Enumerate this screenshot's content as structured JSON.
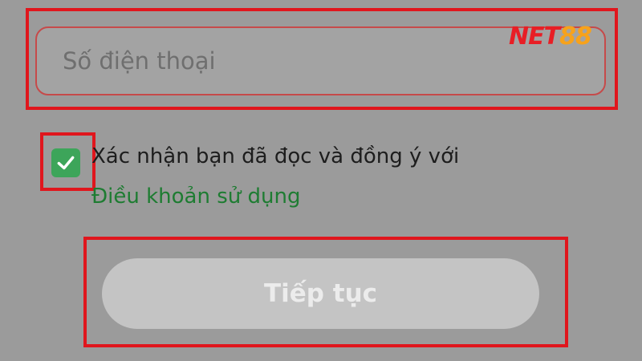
{
  "form": {
    "phone_placeholder": "Số điện thoại",
    "phone_value": "",
    "agree_checked": true,
    "agree_text": "Xác nhận bạn đã đọc và đồng ý với",
    "terms_link": "Điều khoản sử dụng",
    "continue_label": "Tiếp tục"
  },
  "brand": {
    "logo_part1": "NET",
    "logo_part2": "88"
  },
  "colors": {
    "background": "#9b9b9b",
    "highlight": "#e0161d",
    "checkbox": "#3da55a",
    "link": "#1e7c32",
    "button": "#c4c4c4",
    "logo_red": "#e81e25",
    "logo_orange": "#f7a21b"
  },
  "icons": {
    "checkbox_mark": "check-icon"
  }
}
